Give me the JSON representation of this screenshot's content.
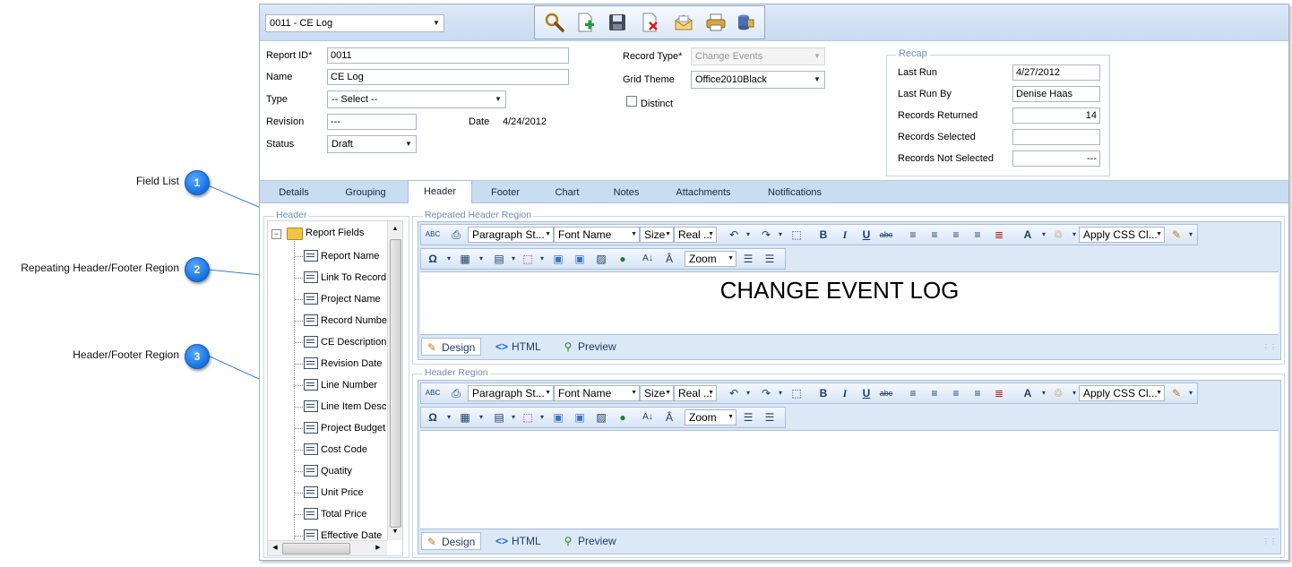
{
  "callouts": [
    {
      "number": "1",
      "label": "Field List"
    },
    {
      "number": "2",
      "label": "Repeating Header/Footer Region"
    },
    {
      "number": "3",
      "label": "Header/Footer Region"
    }
  ],
  "topbar": {
    "report_select_value": "0011 - CE Log"
  },
  "toolbar_icons": [
    "search-icon",
    "new-icon",
    "save-icon",
    "delete-icon",
    "email-icon",
    "print-icon",
    "export-icon"
  ],
  "form": {
    "report_id_label": "Report ID*",
    "report_id_value": "0011",
    "name_label": "Name",
    "name_value": "CE Log",
    "type_label": "Type",
    "type_value": "-- Select --",
    "revision_label": "Revision",
    "revision_value": "---",
    "date_label": "Date",
    "date_value": "4/24/2012",
    "status_label": "Status",
    "status_value": "Draft",
    "record_type_label": "Record Type*",
    "record_type_value": "Change Events",
    "grid_theme_label": "Grid Theme",
    "grid_theme_value": "Office2010Black",
    "distinct_label": "Distinct"
  },
  "recap": {
    "legend": "Recap",
    "last_run_label": "Last Run",
    "last_run_value": "4/27/2012",
    "last_run_by_label": "Last Run By",
    "last_run_by_value": "Denise Haas",
    "records_returned_label": "Records Returned",
    "records_returned_value": "14",
    "records_selected_label": "Records Selected",
    "records_selected_value": "",
    "records_not_selected_label": "Records Not Selected",
    "records_not_selected_value": "---"
  },
  "tabs": [
    "Details",
    "Grouping",
    "Header",
    "Footer",
    "Chart",
    "Notes",
    "Attachments",
    "Notifications"
  ],
  "active_tab": "Header",
  "header_section": {
    "legend": "Header",
    "tree_root": "Report Fields",
    "fields": [
      "Report Name",
      "Link To Record",
      "Project Name",
      "Record Number",
      "CE Description",
      "Revision Date",
      "Line Number",
      "Line Item Desc",
      "Project Budget",
      "Cost Code",
      "Quatity",
      "Unit Price",
      "Total Price",
      "Effective Date"
    ]
  },
  "editor_toolbar": {
    "paragraph_style": "Paragraph St...",
    "font_name": "Font Name",
    "size": "Size",
    "real": "Real ...",
    "css_class": "Apply CSS Cl...",
    "zoom": "Zoom"
  },
  "repeated_header": {
    "legend": "Repeated Header Region",
    "content": "CHANGE EVENT LOG"
  },
  "header_region": {
    "legend": "Header Region",
    "content": ""
  },
  "modes": {
    "design": "Design",
    "html": "HTML",
    "preview": "Preview"
  }
}
